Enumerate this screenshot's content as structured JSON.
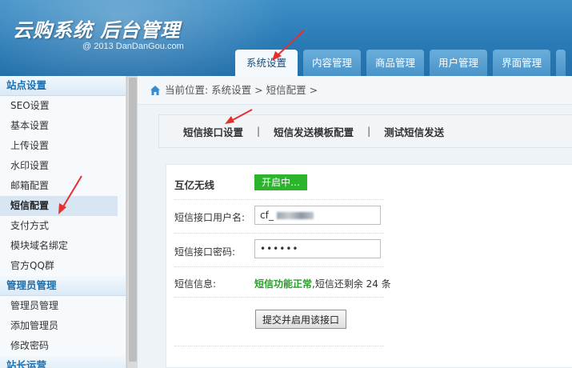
{
  "header": {
    "title": "云购系统 后台管理",
    "subtitle": "@ 2013  DanDanGou.com",
    "tabs": [
      {
        "label": "系统设置",
        "active": true
      },
      {
        "label": "内容管理"
      },
      {
        "label": "商品管理"
      },
      {
        "label": "用户管理"
      },
      {
        "label": "界面管理"
      }
    ]
  },
  "sidebar": {
    "sections": [
      {
        "title": "站点设置",
        "items": [
          "SEO设置",
          "基本设置",
          "上传设置",
          "水印设置",
          "邮箱配置",
          "短信配置",
          "支付方式",
          "模块域名绑定",
          "官方QQ群"
        ]
      },
      {
        "title": "管理员管理",
        "items": [
          "管理员管理",
          "添加管理员",
          "修改密码"
        ]
      },
      {
        "title": "站长运营",
        "items": []
      }
    ],
    "active_item": "短信配置"
  },
  "breadcrumb": "当前位置: 系统设置 > 短信配置 >",
  "subnav": {
    "links": [
      "短信接口设置",
      "短信发送模板配置",
      "测试短信发送"
    ],
    "separator": "|"
  },
  "form": {
    "provider": "互亿无线",
    "status": "开启中…",
    "username_label": "短信接口用户名:",
    "username_value": "cf_",
    "password_label": "短信接口密码:",
    "password_value": "••••••",
    "info_label": "短信信息:",
    "info_ok": "短信功能正常",
    "info_rest": ",短信还剩余 24 条",
    "submit_label": "提交并启用该接口"
  },
  "colors": {
    "header_blue": "#2a7bb6",
    "status_green": "#2cb52c",
    "annotation_red": "#e53030"
  }
}
